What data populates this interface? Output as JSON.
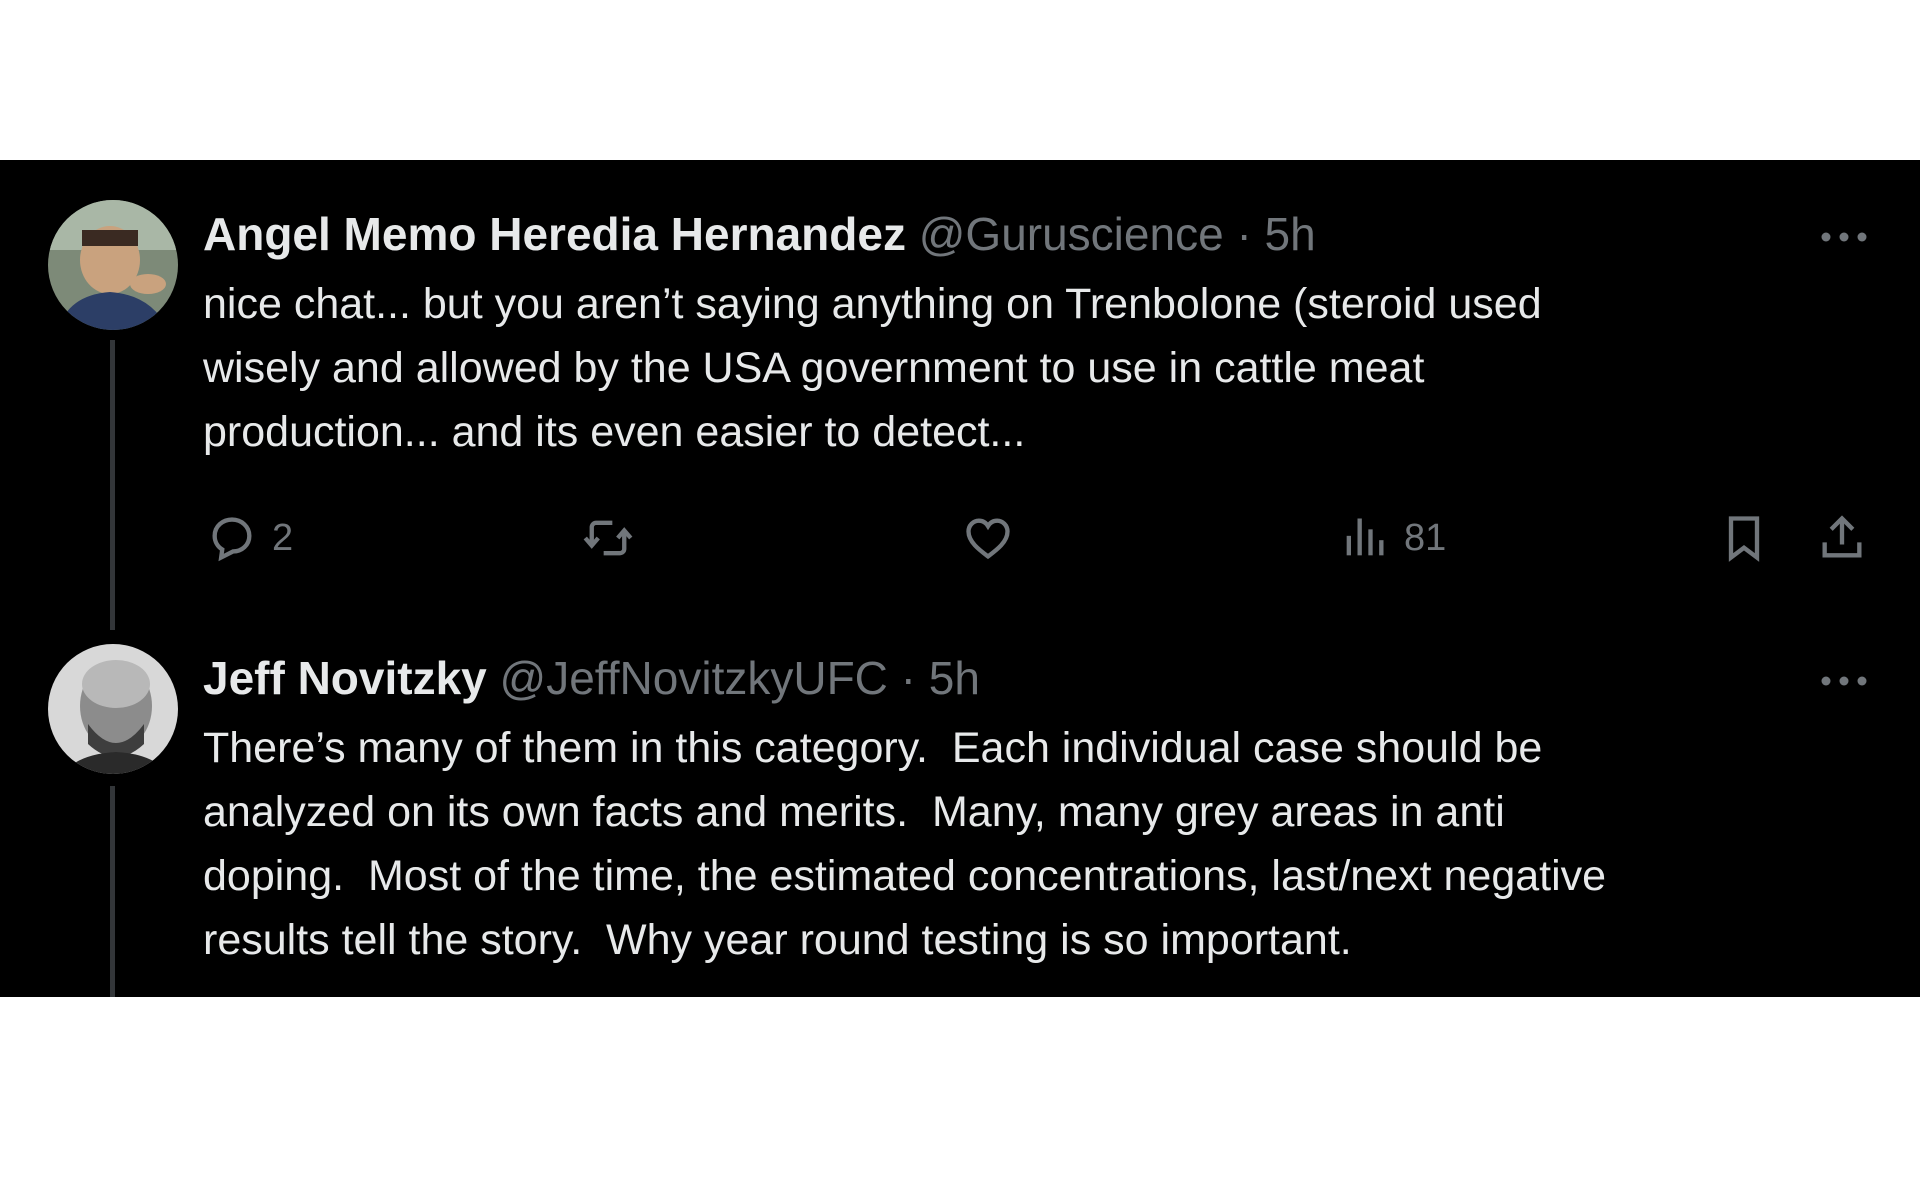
{
  "tweets": [
    {
      "name": "Angel Memo Heredia Hernandez",
      "handle": "@Guruscience",
      "separator": "·",
      "time": "5h",
      "text": "nice chat... but you aren’t saying anything on Trenbolone (steroid used\nwisely and allowed by the USA government to use in cattle meat\nproduction... and its even easier to detect...",
      "actions": {
        "reply_count": "2",
        "retweet_count": "",
        "like_count": "",
        "views_count": "81"
      },
      "icons": [
        "reply-icon",
        "retweet-icon",
        "like-icon",
        "views-icon",
        "bookmark-icon",
        "share-icon",
        "more-icon"
      ]
    },
    {
      "name": "Jeff Novitzky",
      "handle": "@JeffNovitzkyUFC",
      "separator": "·",
      "time": "5h",
      "text": "There’s many of them in this category.  Each individual case should be\nanalyzed on its own facts and merits.  Many, many grey areas in anti\ndoping.  Most of the time, the estimated concentrations, last/next negative\nresults tell the story.  Why year round testing is so important.",
      "icons": [
        "more-icon"
      ]
    }
  ],
  "colors": {
    "background": "#000000",
    "text_primary": "#e7e9ea",
    "text_secondary": "#71767b",
    "thread_line": "#333639"
  }
}
